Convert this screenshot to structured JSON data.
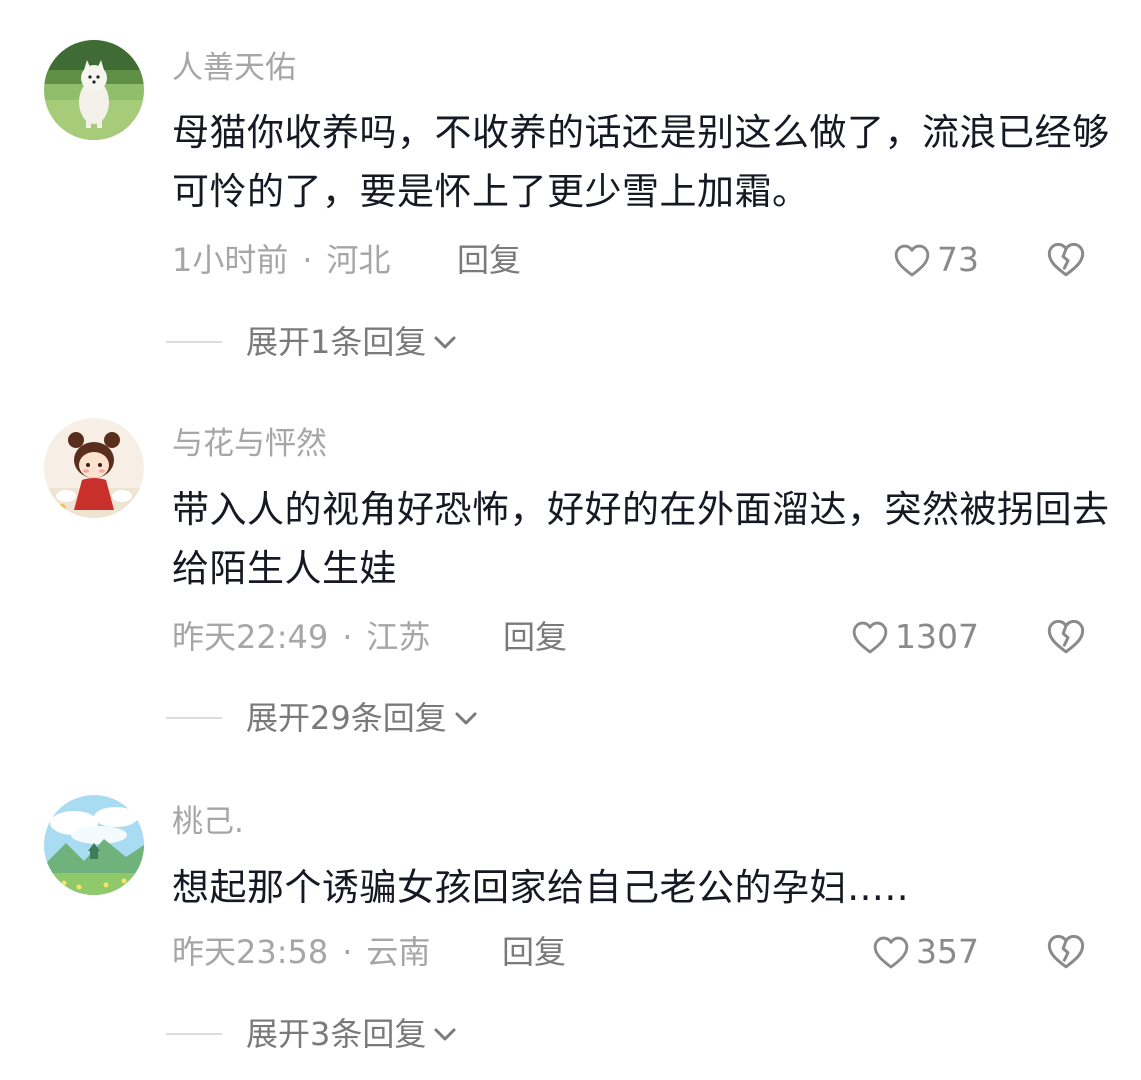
{
  "comments": [
    {
      "username": "人善天佑",
      "text": "母猫你收养吗，不收养的话还是别这么做了，流浪已经够可怜的了，要是怀上了更少雪上加霜。",
      "time": "1小时前",
      "location": "河北",
      "reply_label": "回复",
      "likes": "73",
      "expand_label": "展开1条回复",
      "avatar_icon": "white-dog-on-grass-avatar"
    },
    {
      "username": "与花与怦然",
      "text": "带入人的视角好恐怖，好好的在外面溜达，突然被拐回去给陌生人生娃",
      "time": "昨天22:49",
      "location": "江苏",
      "reply_label": "回复",
      "likes": "1307",
      "expand_label": "展开29条回复",
      "avatar_icon": "cartoon-girl-avatar"
    },
    {
      "username": "桃己.",
      "text": "想起那个诱骗女孩回家给自己老公的孕妇…..",
      "time": "昨天23:58",
      "location": "云南",
      "reply_label": "回复",
      "likes": "357",
      "expand_label": "展开3条回复",
      "avatar_icon": "landscape-sky-avatar"
    }
  ],
  "separator": "·",
  "icons": {
    "like": "heart-outline-icon",
    "dislike": "broken-heart-icon",
    "expand": "chevron-down-icon"
  },
  "colors": {
    "text_primary": "#161823",
    "text_secondary": "#a6a6a6",
    "text_tertiary": "#7a7a7a"
  }
}
